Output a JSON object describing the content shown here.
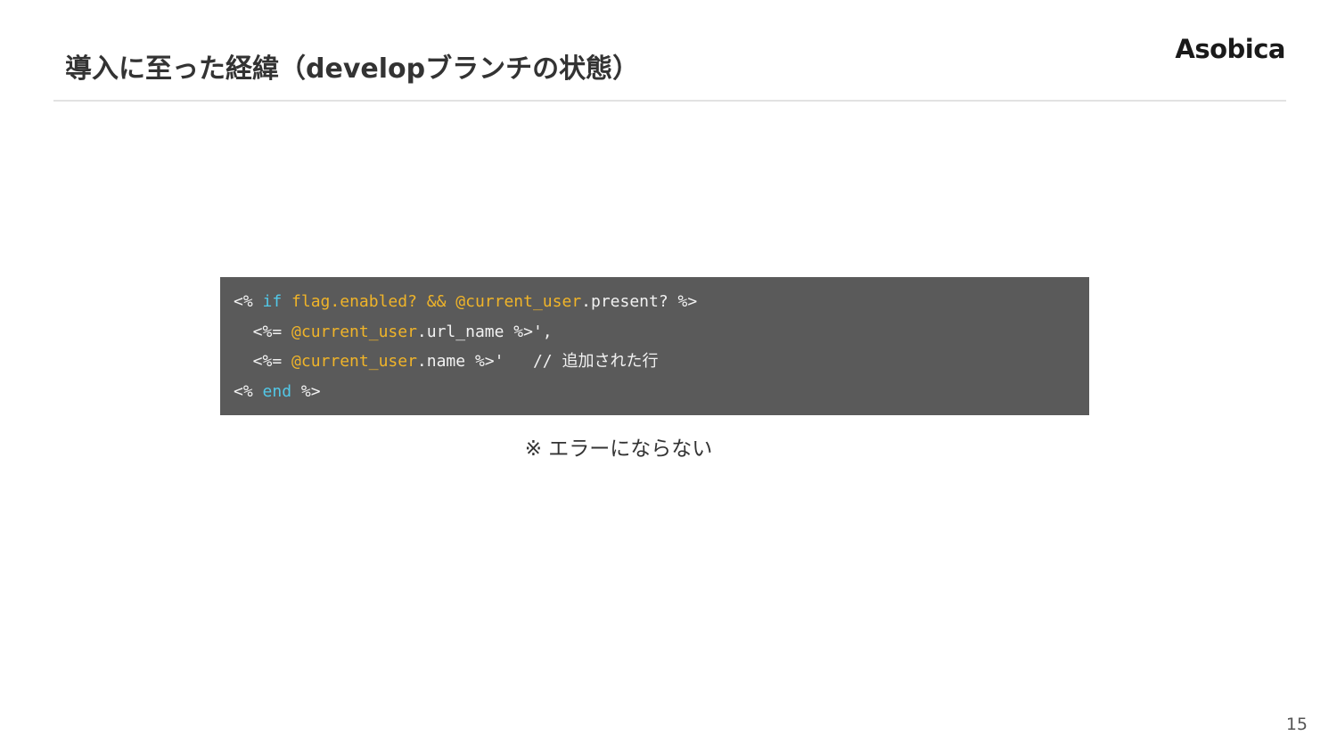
{
  "slide": {
    "title": "導入に至った経緯（developブランチの状態）",
    "logo_text": "Asobica",
    "caption": "※ エラーにならない",
    "page_number": "15"
  },
  "code": {
    "lines": [
      [
        {
          "text": "<% ",
          "style": "plain"
        },
        {
          "text": "if",
          "style": "kw"
        },
        {
          "text": " ",
          "style": "plain"
        },
        {
          "text": "flag.enabled? && @current_user",
          "style": "var"
        },
        {
          "text": ".present? %>",
          "style": "plain"
        }
      ],
      [
        {
          "text": "  <%= ",
          "style": "plain"
        },
        {
          "text": "@current_user",
          "style": "var"
        },
        {
          "text": ".url_name %>',",
          "style": "plain"
        }
      ],
      [
        {
          "text": "  <%= ",
          "style": "plain"
        },
        {
          "text": "@current_user",
          "style": "var"
        },
        {
          "text": ".name %>'   // 追加された行",
          "style": "plain"
        }
      ],
      [
        {
          "text": "<% ",
          "style": "plain"
        },
        {
          "text": "end",
          "style": "kw"
        },
        {
          "text": " %>",
          "style": "plain"
        }
      ]
    ]
  },
  "colors": {
    "code_background": "#5a5a5a",
    "keyword": "#52c8e8",
    "variable": "#f0b429",
    "code_text": "#f2f2f2"
  }
}
